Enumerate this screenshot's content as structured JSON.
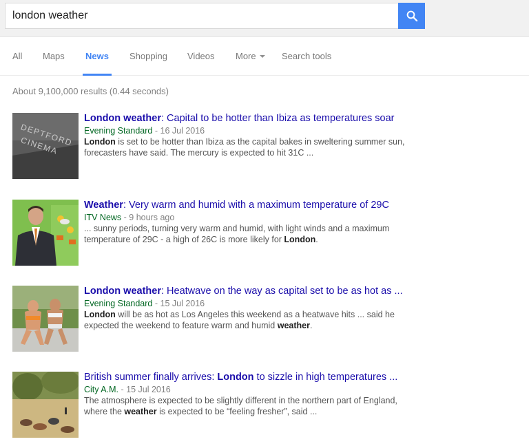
{
  "search": {
    "query": "london weather"
  },
  "tabs": [
    {
      "label": "All"
    },
    {
      "label": "Maps"
    },
    {
      "label": "News"
    },
    {
      "label": "Shopping"
    },
    {
      "label": "Videos"
    },
    {
      "label": "More"
    },
    {
      "label": "Search tools"
    }
  ],
  "active_tab": "News",
  "stats": "About 9,100,000 results (0.44 seconds)",
  "results": [
    {
      "title_bold": "London weather",
      "title_rest": ": Capital to be hotter than Ibiza as temperatures soar",
      "source": "Evening Standard",
      "date": " - 16 Jul 2016",
      "snippet": [
        {
          "t": "London",
          "b": true
        },
        {
          "t": " is set to be hotter than Ibiza as the capital bakes in sweltering summer sun, forecasters have said. The mercury is expected to hit 31C ...",
          "b": false
        }
      ],
      "thumb_text": [
        "DEPTFORD",
        "CINEMA"
      ]
    },
    {
      "title_bold": "Weather",
      "title_rest": ": Very warm and humid with a maximum temperature of 29C",
      "source": "ITV News",
      "date": " - 9 hours ago",
      "snippet": [
        {
          "t": "... sunny periods, turning very warm and humid, with light winds and a maximum temperature of 29C - a high of 26C is more likely for ",
          "b": false
        },
        {
          "t": "London",
          "b": true
        },
        {
          "t": ".",
          "b": false
        }
      ]
    },
    {
      "title_bold": "London weather",
      "title_rest": ": Heatwave on the way as capital set to be as hot as ...",
      "source": "Evening Standard",
      "date": " - 15 Jul 2016",
      "snippet": [
        {
          "t": "London",
          "b": true
        },
        {
          "t": " will be as hot as Los Angeles this weekend as a heatwave hits ... said he expected the weekend to feature warm and humid ",
          "b": false
        },
        {
          "t": "weather",
          "b": true
        },
        {
          "t": ".",
          "b": false
        }
      ]
    },
    {
      "title_pre": "British summer finally arrives: ",
      "title_bold": "London",
      "title_rest": " to sizzle in high temperatures ...",
      "source": "City A.M.",
      "date": " - 15 Jul 2016",
      "snippet": [
        {
          "t": "The atmosphere is expected to be slightly different in the northern part of England, where the ",
          "b": false
        },
        {
          "t": "weather",
          "b": true
        },
        {
          "t": " is expected to be “feeling fresher”, said ...",
          "b": false
        }
      ]
    }
  ],
  "colors": {
    "accent": "#4285f4",
    "link": "#1a0dab",
    "source": "#006621",
    "muted": "#808080"
  }
}
